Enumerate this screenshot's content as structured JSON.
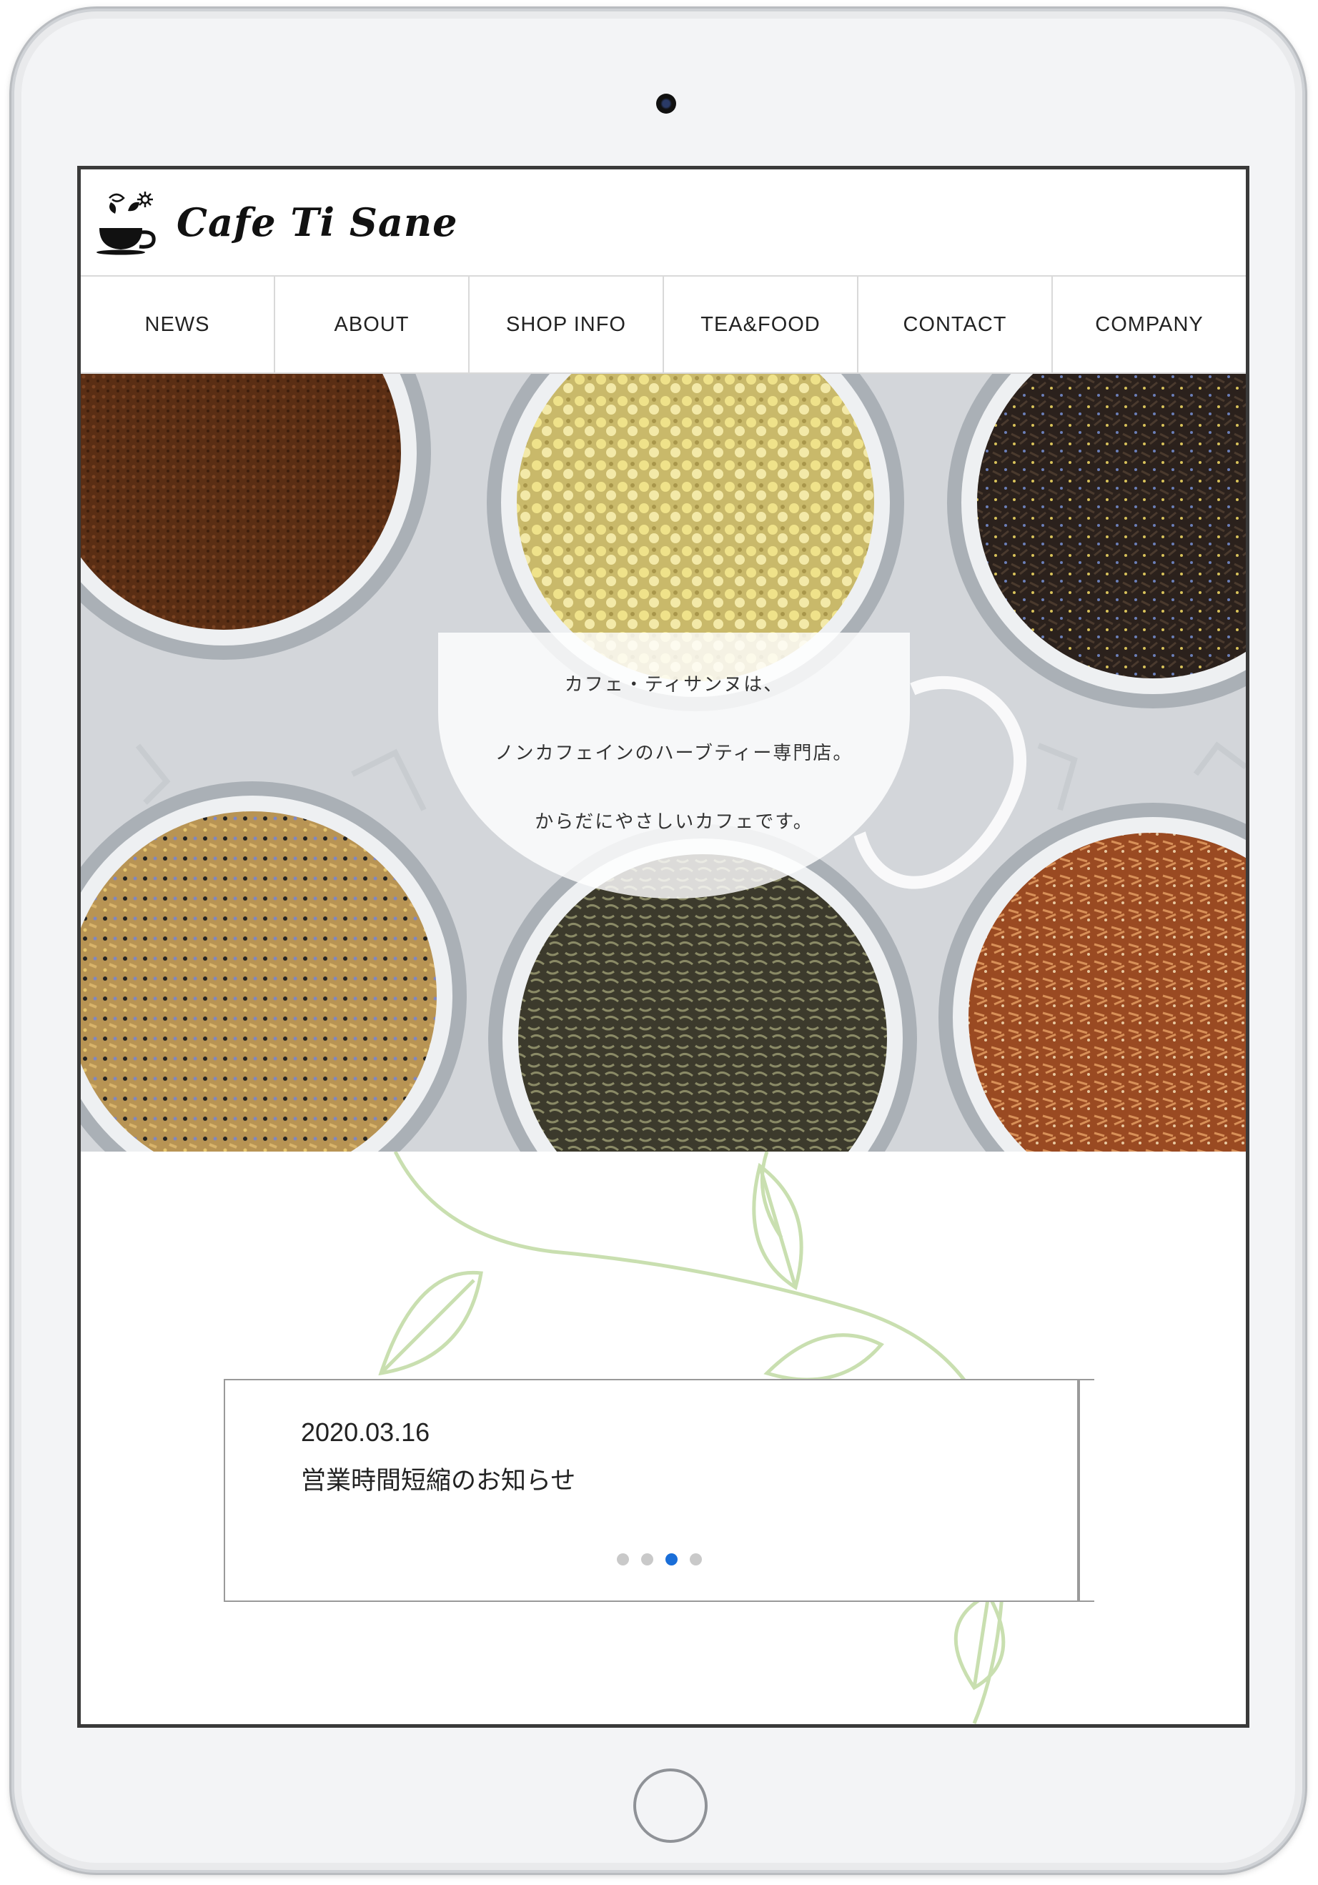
{
  "site": {
    "logo_text": "Cafe Ti Sane",
    "logo_icon": "teacup-flower-icon"
  },
  "nav": {
    "items": [
      {
        "label": "NEWS"
      },
      {
        "label": "ABOUT"
      },
      {
        "label": "SHOP INFO"
      },
      {
        "label": "TEA&FOOD"
      },
      {
        "label": "CONTACT"
      },
      {
        "label": "COMPANY"
      }
    ]
  },
  "hero": {
    "lines": [
      "カフェ・ティサンヌは、",
      "ノンカフェインのハーブティー専門店。",
      "からだにやさしいカフェです。"
    ]
  },
  "news": {
    "date": "2020.03.16",
    "title": "営業時間短縮のお知らせ",
    "slide_count": 4,
    "active_slide_number": 3
  },
  "colors": {
    "accent": "#1a6ed8",
    "vine": "#c9dfb0",
    "frame": "#3a3a3a"
  }
}
